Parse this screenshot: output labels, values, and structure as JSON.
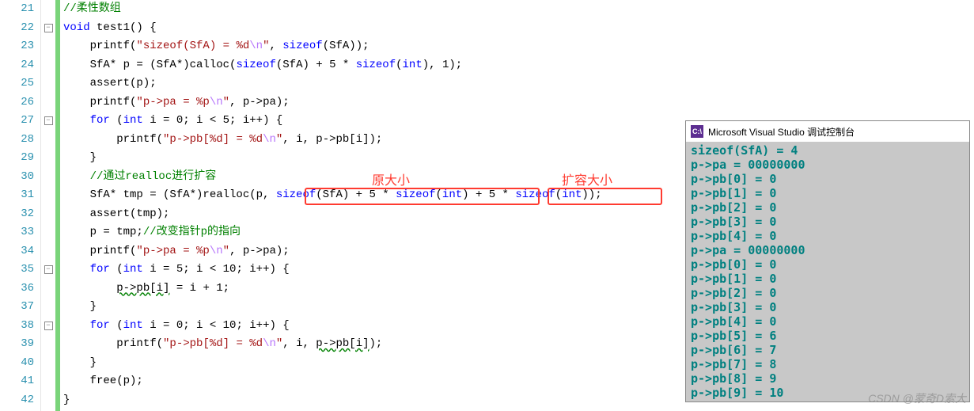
{
  "lines": {
    "start": 21,
    "end": 42
  },
  "code": {
    "l21_cmt": "//柔性数组",
    "l22_kw_void": "void",
    "l22_fn": " test1() {",
    "l23_pre": "    printf(",
    "l23_s1": "\"sizeof(SfA) = %d",
    "l23_esc": "\\n",
    "l23_s2": "\"",
    "l23_mid": ", ",
    "l23_sz": "sizeof",
    "l23_p1": "(SfA));",
    "l24_pre": "    SfA* p = (SfA*)calloc(",
    "l24_sz1": "sizeof",
    "l24_a1": "(SfA) + 5 * ",
    "l24_sz2": "sizeof",
    "l24_a2": "(",
    "l24_int": "int",
    "l24_a3": "), 1);",
    "l25": "    assert(p);",
    "l26_pre": "    printf(",
    "l26_s1": "\"p->pa = %p",
    "l26_esc": "\\n",
    "l26_s2": "\"",
    "l26_end": ", p->pa);",
    "l27_for": "    for",
    "l27_a": " (",
    "l27_int": "int",
    "l27_b": " i = 0; i < 5; i++) {",
    "l28_pre": "        printf(",
    "l28_s1": "\"p->pb[%d] = %d",
    "l28_esc": "\\n",
    "l28_s2": "\"",
    "l28_end": ", i, p->pb[i]);",
    "l29": "    }",
    "l30_cmt": "    //通过realloc进行扩容",
    "l31_pre": "    SfA* tmp = (SfA*)realloc(p, ",
    "l31_sz1": "sizeof",
    "l31_a1": "(SfA) + 5 * ",
    "l31_sz2": "sizeof",
    "l31_a2": "(",
    "l31_int1": "int",
    "l31_a3": ") + 5 * ",
    "l31_sz3": "sizeof",
    "l31_a4": "(",
    "l31_int2": "int",
    "l31_a5": "));",
    "l32": "    assert(tmp);",
    "l33_a": "    p = tmp;",
    "l33_cmt": "//改变指针p的指向",
    "l34_pre": "    printf(",
    "l34_s1": "\"p->pa = %p",
    "l34_esc": "\\n",
    "l34_s2": "\"",
    "l34_end": ", p->pa);",
    "l35_for": "    for",
    "l35_a": " (",
    "l35_int": "int",
    "l35_b": " i = 5; i < 10; i++) {",
    "l36_a": "        ",
    "l36_w": "p->pb[i]",
    "l36_b": " = i + 1;",
    "l37": "    }",
    "l38_for": "    for",
    "l38_a": " (",
    "l38_int": "int",
    "l38_b": " i = 0; i < 10; i++) {",
    "l39_pre": "        printf(",
    "l39_s1": "\"p->pb[%d] = %d",
    "l39_esc": "\\n",
    "l39_s2": "\"",
    "l39_mid": ", i, ",
    "l39_w": "p->pb[i]",
    "l39_end": ");",
    "l40": "    }",
    "l41": "    free(p);",
    "l42": "}"
  },
  "annotations": {
    "label_original": "原大小",
    "label_expand": "扩容大小"
  },
  "console": {
    "title": "Microsoft Visual Studio 调试控制台",
    "icon": "C:\\",
    "lines": [
      "sizeof(SfA) = 4",
      "p->pa = 00000000",
      "p->pb[0] = 0",
      "p->pb[1] = 0",
      "p->pb[2] = 0",
      "p->pb[3] = 0",
      "p->pb[4] = 0",
      "p->pa = 00000000",
      "p->pb[0] = 0",
      "p->pb[1] = 0",
      "p->pb[2] = 0",
      "p->pb[3] = 0",
      "p->pb[4] = 0",
      "p->pb[5] = 6",
      "p->pb[6] = 7",
      "p->pb[7] = 8",
      "p->pb[8] = 9",
      "p->pb[9] = 10"
    ]
  },
  "watermark": "CSDN @蒙奇D索大"
}
